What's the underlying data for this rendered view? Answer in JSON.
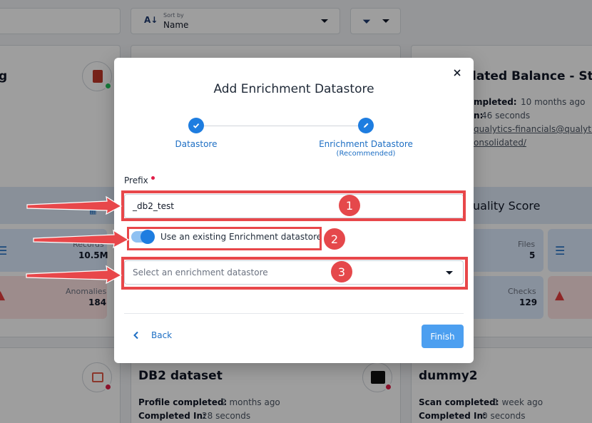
{
  "background": {
    "sort": {
      "caption": "Sort by",
      "value": "Name"
    },
    "cards": {
      "left_partial_title": "g",
      "right_title_partial": "lated Balance - Stag",
      "right_line1_label": "mpleted:",
      "right_line1_value": "10 months ago",
      "right_line2_label": "n:",
      "right_line2_value": "46 seconds",
      "right_link1": "qualytics-financials@qualytic",
      "right_link2": "onsolidated/",
      "quality_score_partial": "uality Score",
      "left_records_label": "Records",
      "left_records_value": "10.5M",
      "left_anomalies_label": "Anomalies",
      "left_anomalies_value": "184",
      "right_files_label": "Files",
      "right_files_value": "5",
      "right_checks_label": "Checks",
      "right_checks_value": "129",
      "db2_title": "DB2 dataset",
      "db2_line1_label": "Profile completed:",
      "db2_line1_value": "2 months ago",
      "db2_line2_label": "Completed In:",
      "db2_line2_value": "28 seconds",
      "dummy_title": "dummy2",
      "dummy_line1_label": "Scan completed:",
      "dummy_line1_value": "1 week ago",
      "dummy_line2_label": "Completed In:",
      "dummy_line2_value": "0 seconds"
    }
  },
  "modal": {
    "title": "Add Enrichment Datastore",
    "steps": [
      {
        "label": "Datastore",
        "icon": "check-icon"
      },
      {
        "label": "Enrichment Datastore",
        "sub": "(Recommended)",
        "icon": "pencil-icon"
      }
    ],
    "prefix_label": "Prefix",
    "prefix_value": "_db2_test",
    "toggle_label": "Use an existing Enrichment datastore",
    "toggle_on": true,
    "select_placeholder": "Select an enrichment datastore",
    "back_label": "Back",
    "finish_label": "Finish"
  },
  "callouts": [
    "1",
    "2",
    "3"
  ],
  "colors": {
    "accent": "#1e7de0",
    "callout": "#e8474a",
    "finish": "#4c9ff0"
  }
}
